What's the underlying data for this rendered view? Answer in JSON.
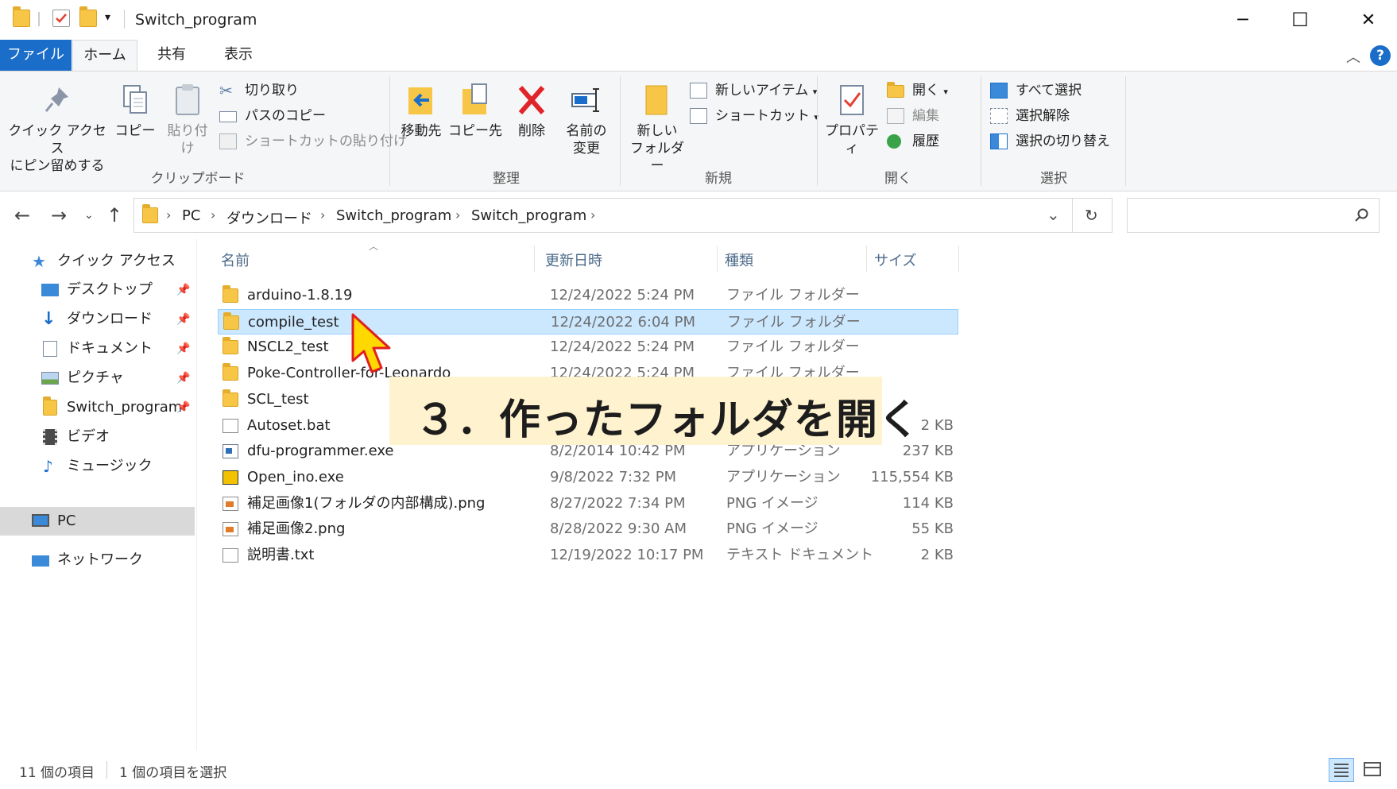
{
  "window": {
    "title": "Switch_program",
    "minimize": "─",
    "maximize": "☐",
    "close": "✕"
  },
  "tabs": [
    "ファイル",
    "ホーム",
    "共有",
    "表示"
  ],
  "ribbon": {
    "clipboard": {
      "label": "クリップボード",
      "pin_label_1": "クイック アクセス",
      "pin_label_2": "にピン留めする",
      "copy": "コピー",
      "paste": "貼り付け",
      "cut": "切り取り",
      "copy_path": "パスのコピー",
      "paste_shortcut": "ショートカットの貼り付け"
    },
    "organize": {
      "label": "整理",
      "move_to": "移動先",
      "copy_to": "コピー先",
      "delete": "削除",
      "rename_1": "名前の",
      "rename_2": "変更"
    },
    "new": {
      "label": "新規",
      "new_folder_1": "新しい",
      "new_folder_2": "フォルダー",
      "new_item": "新しいアイテム",
      "shortcut": "ショートカット"
    },
    "open": {
      "label": "開く",
      "properties": "プロパティ",
      "open": "開く",
      "edit": "編集",
      "history": "履歴"
    },
    "select": {
      "label": "選択",
      "select_all": "すべて選択",
      "select_none": "選択解除",
      "invert": "選択の切り替え"
    }
  },
  "address": {
    "crumbs": [
      "PC",
      "ダウンロード",
      "Switch_program",
      "Switch_program"
    ],
    "search_placeholder": ""
  },
  "navpane": {
    "quick_access": "クイック アクセス",
    "items": [
      {
        "label": "デスクトップ",
        "icon": "desktop-icon",
        "pinned": true
      },
      {
        "label": "ダウンロード",
        "icon": "download-icon",
        "pinned": true
      },
      {
        "label": "ドキュメント",
        "icon": "document-icon",
        "pinned": true
      },
      {
        "label": "ピクチャ",
        "icon": "picture-icon",
        "pinned": true
      },
      {
        "label": "Switch_program",
        "icon": "folder-icon",
        "pinned": true
      },
      {
        "label": "ビデオ",
        "icon": "video-icon",
        "pinned": false
      },
      {
        "label": "ミュージック",
        "icon": "music-icon",
        "pinned": false
      }
    ],
    "pc": "PC",
    "network": "ネットワーク"
  },
  "columns": {
    "name": "名前",
    "date": "更新日時",
    "type": "種類",
    "size": "サイズ"
  },
  "files": [
    {
      "name": "arduino-1.8.19",
      "date": "12/24/2022 5:24 PM",
      "type": "ファイル フォルダー",
      "size": "",
      "icon": "folder-icon",
      "selected": false
    },
    {
      "name": "compile_test",
      "date": "12/24/2022 6:04 PM",
      "type": "ファイル フォルダー",
      "size": "",
      "icon": "folder-icon",
      "selected": true
    },
    {
      "name": "NSCL2_test",
      "date": "12/24/2022 5:24 PM",
      "type": "ファイル フォルダー",
      "size": "",
      "icon": "folder-icon",
      "selected": false
    },
    {
      "name": "Poke-Controller-for-Leonardo",
      "date": "12/24/2022 5:24 PM",
      "type": "ファイル フォルダー",
      "size": "",
      "icon": "folder-icon",
      "selected": false
    },
    {
      "name": "SCL_test",
      "date": "",
      "type": "",
      "size": "",
      "icon": "folder-icon",
      "selected": false
    },
    {
      "name": "Autoset.bat",
      "date": "",
      "type": "",
      "size": "2 KB",
      "icon": "batch-file-icon",
      "selected": false
    },
    {
      "name": "dfu-programmer.exe",
      "date": "8/2/2014 10:42 PM",
      "type": "アプリケーション",
      "size": "237 KB",
      "icon": "exe-icon",
      "selected": false
    },
    {
      "name": "Open_ino.exe",
      "date": "9/8/2022 7:32 PM",
      "type": "アプリケーション",
      "size": "115,554 KB",
      "icon": "ino-exe-icon",
      "selected": false
    },
    {
      "name": "補足画像1(フォルダの内部構成).png",
      "date": "8/27/2022 7:34 PM",
      "type": "PNG イメージ",
      "size": "114 KB",
      "icon": "png-icon",
      "selected": false
    },
    {
      "name": "補足画像2.png",
      "date": "8/28/2022 9:30 AM",
      "type": "PNG イメージ",
      "size": "55 KB",
      "icon": "png-icon",
      "selected": false
    },
    {
      "name": "説明書.txt",
      "date": "12/19/2022 10:17 PM",
      "type": "テキスト ドキュメント",
      "size": "2 KB",
      "icon": "text-file-icon",
      "selected": false
    }
  ],
  "status": {
    "count": "11 個の項目",
    "selected": "1 個の項目を選択"
  },
  "annotation": "３．作ったフォルダを開く",
  "colors": {
    "accent": "#1a6ec9",
    "selection": "#cce8ff",
    "callout": "#fff2cc",
    "cursor": "#ffd800"
  }
}
